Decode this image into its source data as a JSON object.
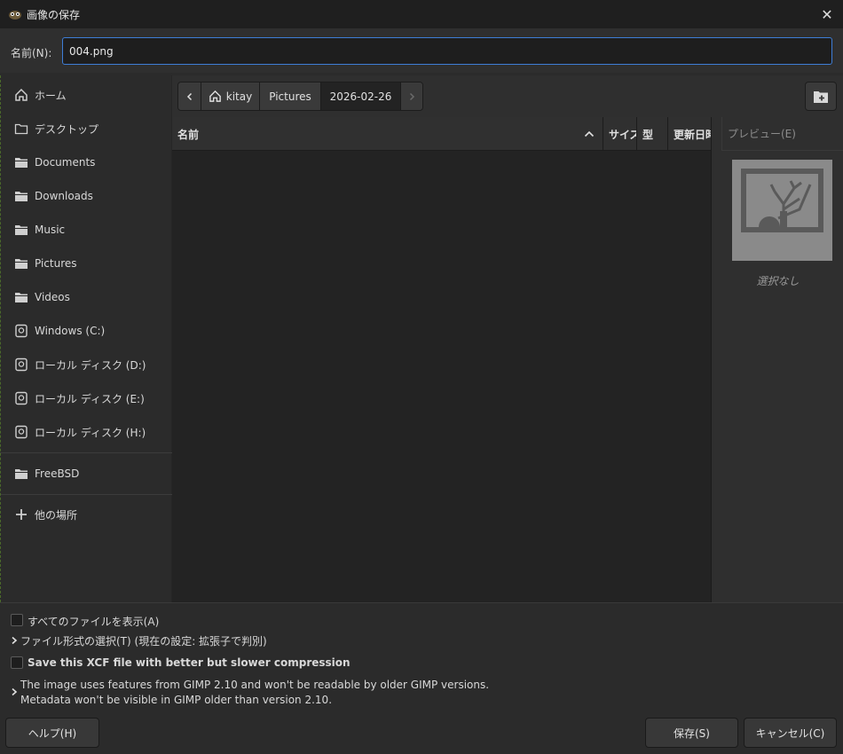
{
  "window": {
    "title": "画像の保存",
    "close_symbol": "✕"
  },
  "name_field": {
    "label": "名前(N):",
    "value": "004.png"
  },
  "sidebar": {
    "items": [
      {
        "label": "ホーム",
        "icon": "home-icon"
      },
      {
        "label": "デスクトップ",
        "icon": "folder-outline-icon"
      },
      {
        "label": "Documents",
        "icon": "folder-icon"
      },
      {
        "label": "Downloads",
        "icon": "folder-icon"
      },
      {
        "label": "Music",
        "icon": "folder-icon"
      },
      {
        "label": "Pictures",
        "icon": "folder-icon"
      },
      {
        "label": "Videos",
        "icon": "folder-icon"
      },
      {
        "label": "Windows (C:)",
        "icon": "drive-icon"
      },
      {
        "label": "ローカル ディスク (D:)",
        "icon": "drive-icon"
      },
      {
        "label": "ローカル ディスク (E:)",
        "icon": "drive-icon"
      },
      {
        "label": "ローカル ディスク (H:)",
        "icon": "drive-icon"
      }
    ],
    "network": [
      {
        "label": "FreeBSD",
        "icon": "folder-icon"
      }
    ],
    "other_locations": {
      "label": "他の場所",
      "icon": "plus-icon"
    }
  },
  "path_bar": {
    "segments": [
      "kitay",
      "Pictures",
      "2026-02-26"
    ],
    "current": "2026-02-26"
  },
  "file_list": {
    "columns": [
      "名前",
      "サイズ",
      "型",
      "更新日時"
    ],
    "sort_column": "名前",
    "sort_direction": "ascending",
    "rows": []
  },
  "preview": {
    "header": "プレビュー(E)",
    "empty_text": "選択なし"
  },
  "options": {
    "show_all_files": {
      "label": "すべてのファイルを表示(A)",
      "checked": false
    },
    "file_type_expander": "ファイル形式の選択(T) (現在の設定: 拡張子で判別)",
    "better_compression": {
      "label": "Save this XCF file with better but slower compression",
      "checked": false
    },
    "compat_notice_line1": "The image uses features from GIMP 2.10 and won't be readable by older GIMP versions.",
    "compat_notice_line2": "Metadata won't be visible in GIMP older than version 2.10."
  },
  "buttons": {
    "help": "ヘルプ(H)",
    "save": "保存(S)",
    "cancel": "キャンセル(C)"
  },
  "colors": {
    "accent_focus_border": "#3e7dd6",
    "background": "#2b2b2b",
    "list_background": "#232323"
  }
}
